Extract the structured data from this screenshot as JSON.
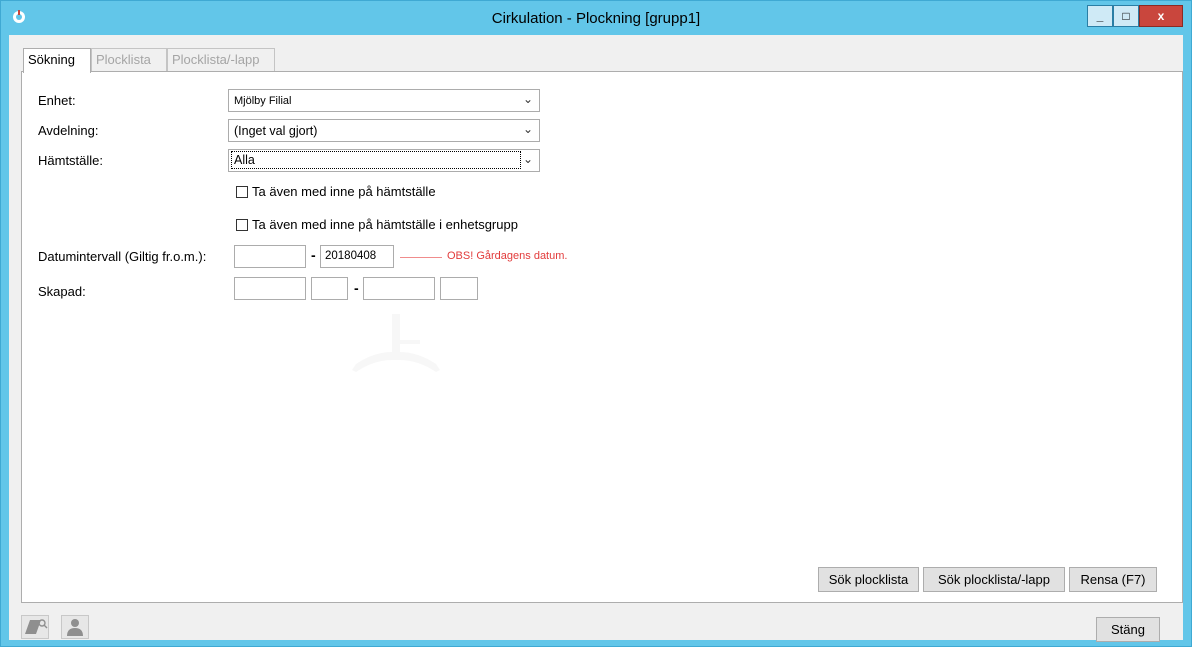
{
  "window": {
    "title": "Cirkulation - Plockning [grupp1]",
    "app_icon": "app-logo-icon",
    "controls": {
      "minimize": "_",
      "maximize": "□",
      "close": "x"
    }
  },
  "tabs": [
    {
      "label": "Sökning",
      "active": true
    },
    {
      "label": "Plocklista",
      "active": false
    },
    {
      "label": "Plocklista/-lapp",
      "active": false
    }
  ],
  "form": {
    "enhet": {
      "label": "Enhet:",
      "value": "Mjölby Filial"
    },
    "avdelning": {
      "label": "Avdelning:",
      "value": "(Inget val gjort)"
    },
    "hamtstalle": {
      "label": "Hämtställe:",
      "value": "Alla"
    },
    "check1": {
      "label": "Ta även med inne på hämtställe",
      "checked": false
    },
    "check2": {
      "label": "Ta även med inne på hämtställe i enhetsgrupp",
      "checked": false
    },
    "datum": {
      "label": "Datumintervall (Giltig fr.o.m.):",
      "from": "",
      "separator": "-",
      "to": "20180408",
      "warning": "OBS! Gårdagens datum."
    },
    "skapad": {
      "label": "Skapad:",
      "from_date": "",
      "from_time": "",
      "separator": "-",
      "to_date": "",
      "to_time": ""
    },
    "arrow": "⌄"
  },
  "buttons": {
    "sok_plocklista": "Sök plocklista",
    "sok_plocklapp": "Sök plocklista/-lapp",
    "rensa": "Rensa (F7)",
    "stang": "Stäng"
  },
  "status_icons": [
    "book-search-icon",
    "user-icon"
  ],
  "colors": {
    "titlebar": "#62c6e9",
    "close": "#c9463d",
    "warning": "#e23b3b"
  }
}
